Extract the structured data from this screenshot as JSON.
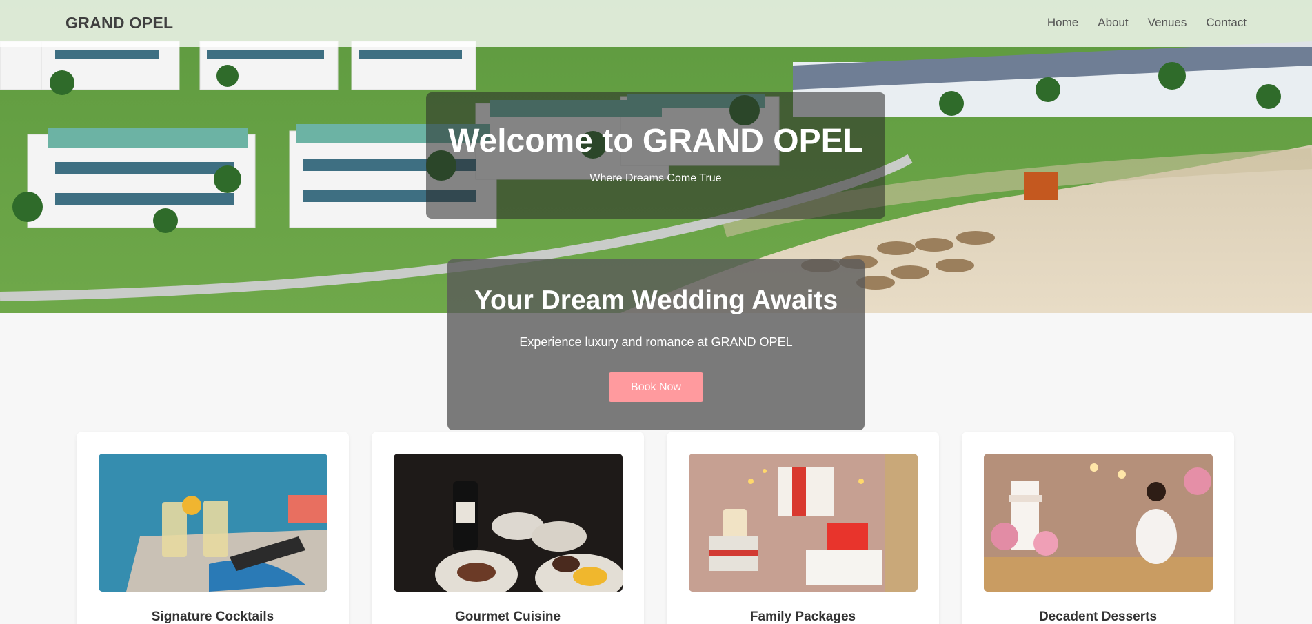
{
  "nav": {
    "logo": "GRAND OPEL",
    "links": [
      "Home",
      "About",
      "Venues",
      "Contact"
    ]
  },
  "hero": {
    "title": "Welcome to GRAND OPEL",
    "subtitle": "Where Dreams Come True"
  },
  "wedding": {
    "title": "Your Dream Wedding Awaits",
    "text": "Experience luxury and romance at GRAND OPEL",
    "button": "Book Now"
  },
  "cards": [
    {
      "title": "Signature Cocktails"
    },
    {
      "title": "Gourmet Cuisine"
    },
    {
      "title": "Family Packages"
    },
    {
      "title": "Decadent Desserts"
    }
  ],
  "colors": {
    "accent": "#ff9a9e",
    "background": "#f7f7f7"
  }
}
